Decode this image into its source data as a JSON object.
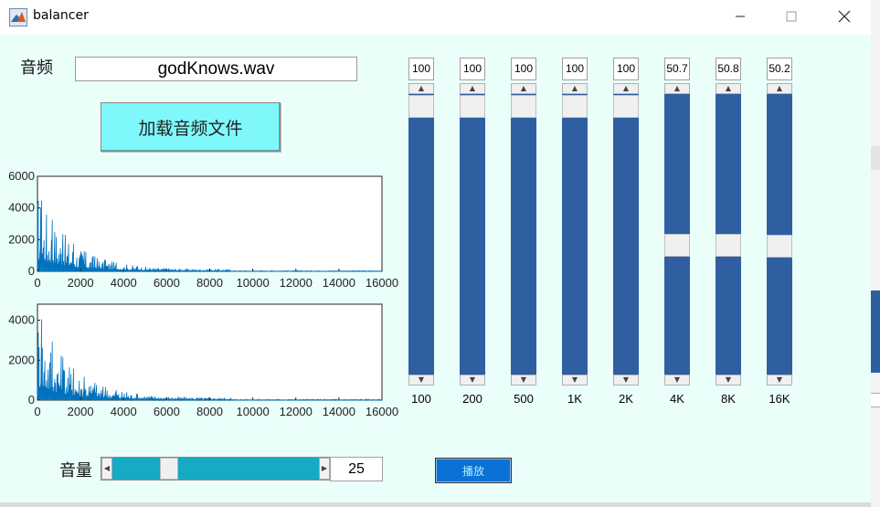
{
  "window": {
    "title": "balancer"
  },
  "icons": {
    "app": "matlab-icon",
    "minimize": "minimize-icon",
    "maximize": "maximize-icon",
    "close": "close-icon"
  },
  "colors": {
    "background": "#eafffa",
    "load_button": "#7ff8fc",
    "eq_track": "#2f5fa0",
    "volume_track": "#17aac4",
    "play_button": "#0a72d6",
    "plot_line": "#0072bd"
  },
  "audio": {
    "label": "音频",
    "filename": "godKnows.wav",
    "load_button": "加载音频文件"
  },
  "plots": [
    {
      "name": "original-spectrum",
      "ylim": [
        0,
        6000
      ],
      "yticks": [
        "0",
        "2000",
        "4000",
        "6000"
      ],
      "xlim": [
        0,
        16000
      ],
      "xticks": [
        "0",
        "2000",
        "4000",
        "6000",
        "8000",
        "10000",
        "12000",
        "14000",
        "16000"
      ]
    },
    {
      "name": "filtered-spectrum",
      "ylim": [
        0,
        4800
      ],
      "yticks": [
        "0",
        "2000",
        "4000"
      ],
      "xlim": [
        0,
        16000
      ],
      "xticks": [
        "0",
        "2000",
        "4000",
        "6000",
        "8000",
        "10000",
        "12000",
        "14000",
        "16000"
      ]
    }
  ],
  "equalizer": [
    {
      "band": "100",
      "value": "100",
      "level": 1.0
    },
    {
      "band": "200",
      "value": "100",
      "level": 1.0
    },
    {
      "band": "500",
      "value": "100",
      "level": 1.0
    },
    {
      "band": "1K",
      "value": "100",
      "level": 1.0
    },
    {
      "band": "2K",
      "value": "100",
      "level": 1.0
    },
    {
      "band": "4K",
      "value": "50.7",
      "level": 0.507
    },
    {
      "band": "8K",
      "value": "50.8",
      "level": 0.508
    },
    {
      "band": "16K",
      "value": "50.2",
      "level": 0.502
    }
  ],
  "volume": {
    "label": "音量",
    "value": "25",
    "level": 0.25
  },
  "play": {
    "label": "播放"
  }
}
